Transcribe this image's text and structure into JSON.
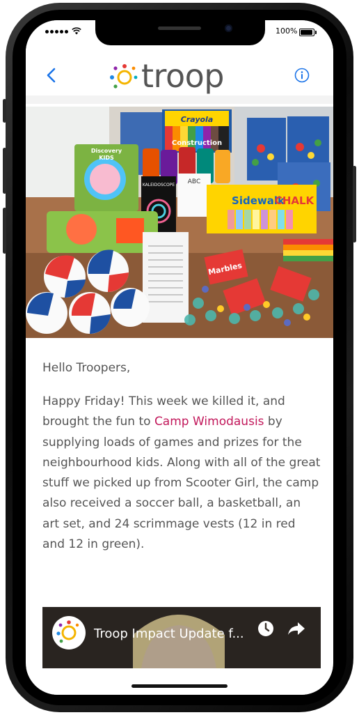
{
  "status_bar": {
    "battery_percent": "100%",
    "battery_level": 1.0
  },
  "navbar": {
    "back_icon": "chevron-left-icon",
    "logo_text": "troop",
    "info_icon": "info-icon",
    "accent_color": "#1a73e8"
  },
  "hero_image": {
    "visible_labels": {
      "discovery": "Discovery",
      "kids": "KIDS",
      "crayola": "Crayola",
      "construction": "Construction",
      "kaleidoscope": "KALEIDOSCOPE",
      "abc": "ABC",
      "sidewalk": "Sidewalk",
      "chalk": "CHALK",
      "marbles": "Marbles"
    }
  },
  "article": {
    "greeting": "Hello Troopers,",
    "paragraph_before_link": "Happy Friday!  This week we killed it, and brought the fun to ",
    "link_text": "Camp Wimodausis",
    "paragraph_after_link": " by supplying loads of games and prizes for the neighbourhood kids.  Along with all of the great stuff we picked up from Scooter Girl, the camp also received a soccer ball, a basketball, an art set, and 24 scrimmage vests (12 in red and 12 in green).",
    "link_color": "#c2185b",
    "text_color": "#555555"
  },
  "video": {
    "title": "Troop Impact Update f...",
    "watch_later_icon": "clock-icon",
    "share_icon": "share-arrow-icon"
  }
}
